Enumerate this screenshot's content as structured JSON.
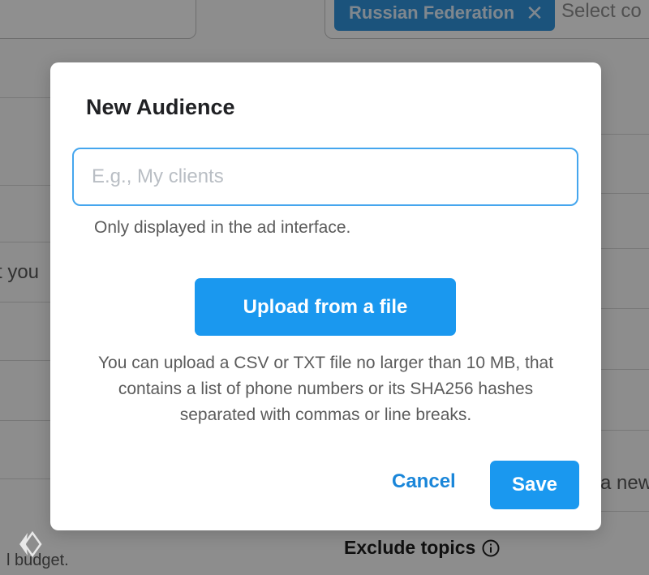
{
  "background": {
    "country_chip": {
      "label": "Russian Federation",
      "remove_icon": "close-icon"
    },
    "country_select_placeholder": "Select co",
    "left_fragment_1": "t you",
    "left_fragment_2": "l budget.",
    "right_fragment": "a new",
    "exclude_topics_label": "Exclude topics",
    "exclude_topics_icon": "info-icon"
  },
  "modal": {
    "title": "New Audience",
    "name_input": {
      "value": "",
      "placeholder": "E.g., My clients"
    },
    "name_hint": "Only displayed in the ad interface.",
    "upload_button_label": "Upload from a file",
    "upload_description": "You can upload a CSV or TXT file no larger than 10 MB, that contains a list of phone numbers or its SHA256 hashes separated with commas or line breaks.",
    "cancel_label": "Cancel",
    "save_label": "Save"
  },
  "colors": {
    "accent": "#1a98ef",
    "link": "#1a86d9",
    "input_focus_border": "#45a6ee",
    "chip_background": "#2f8fd6"
  }
}
